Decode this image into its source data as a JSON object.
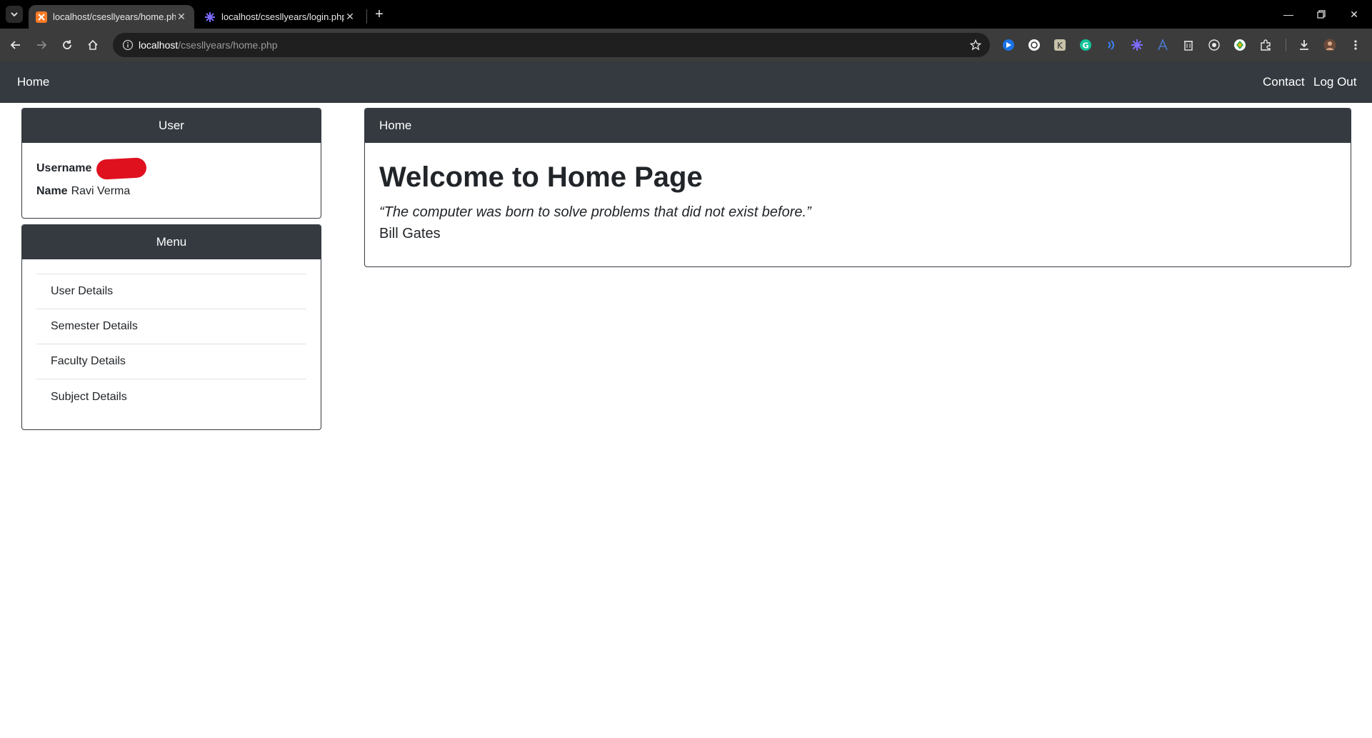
{
  "browser": {
    "tabs": [
      {
        "title": "localhost/csesllyears/home.php",
        "active": true
      },
      {
        "title": "localhost/csesllyears/login.php",
        "active": false
      }
    ],
    "address": {
      "host": "localhost",
      "path": "/csesllyears/home.php"
    }
  },
  "navbar": {
    "brand": "Home",
    "links": [
      "Contact",
      "Log Out"
    ],
    "background": "#343a40"
  },
  "user_card": {
    "header": "User",
    "username_label": "Username",
    "name_label": "Name",
    "name_value": "Ravi Verma"
  },
  "menu_card": {
    "header": "Menu",
    "items": [
      "User Details",
      "Semester Details",
      "Faculty Details",
      "Subject Details"
    ]
  },
  "main_card": {
    "header": "Home",
    "title": "Welcome to Home Page",
    "quote": "“The computer was born to solve problems that did not exist before.”",
    "author": "Bill Gates"
  },
  "colors": {
    "accent_dark": "#343a40",
    "redaction": "#e0111f"
  }
}
